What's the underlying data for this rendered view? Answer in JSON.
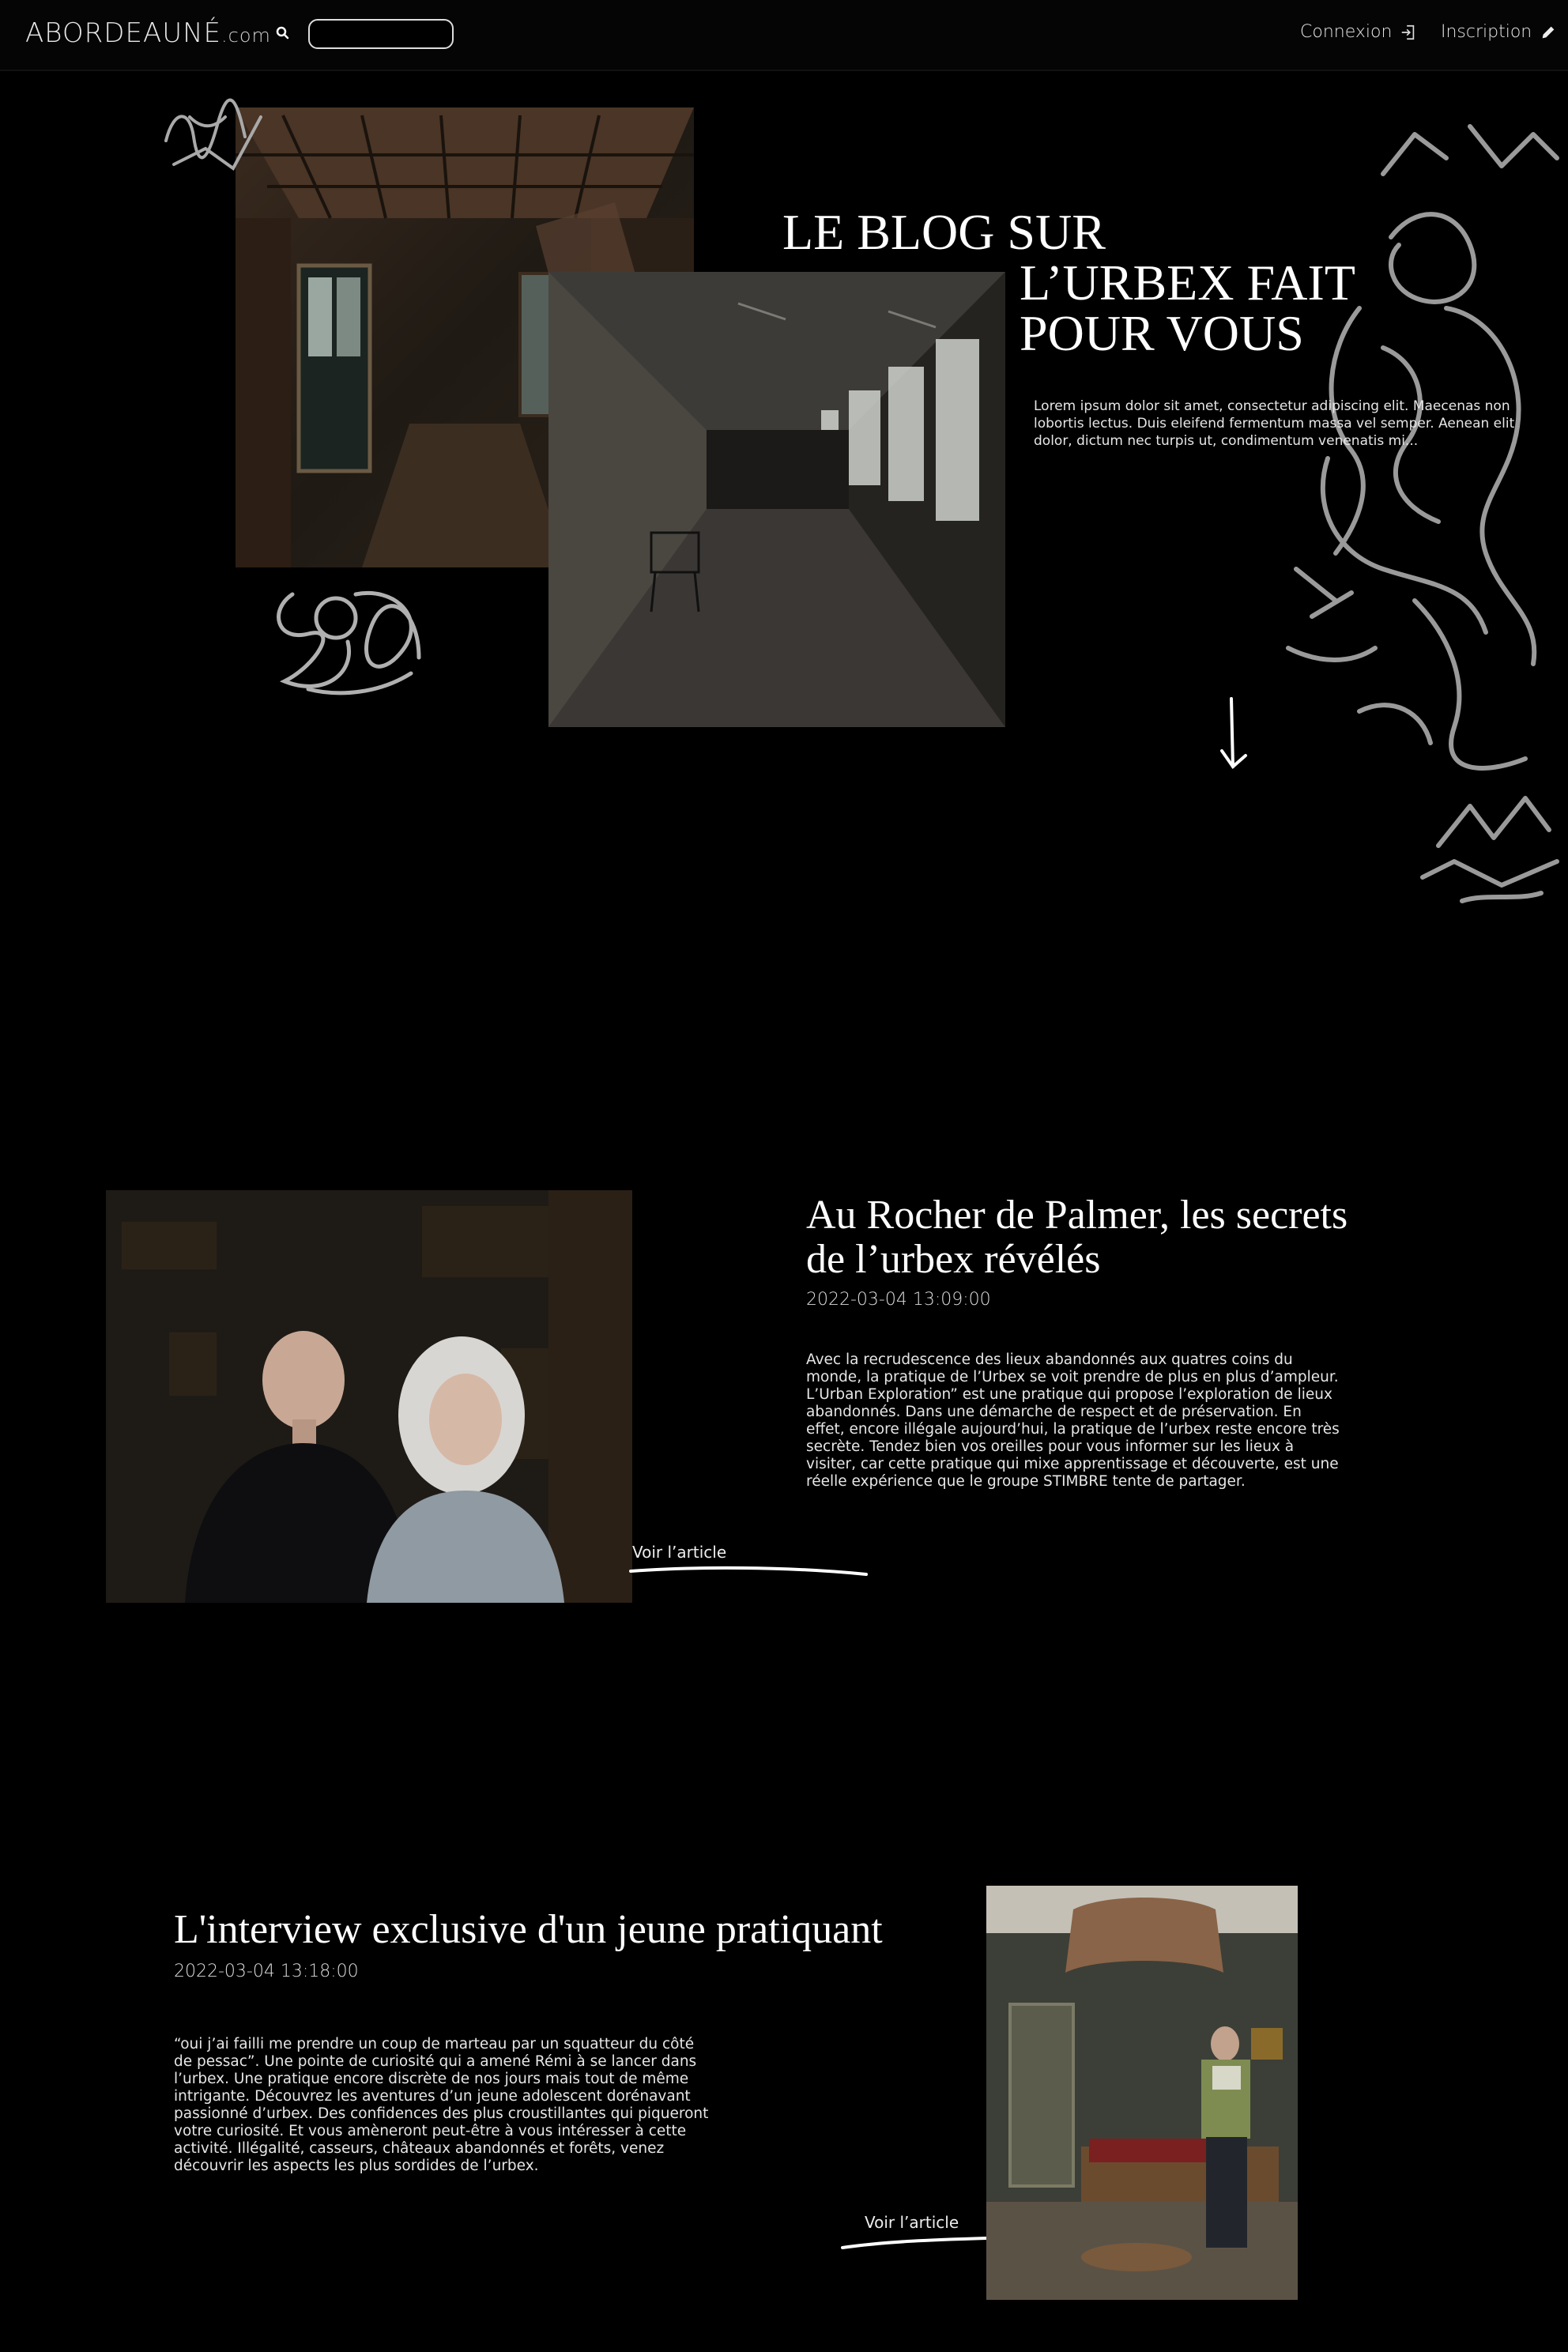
{
  "header": {
    "brand_main": "ABORDEAUNÉ",
    "brand_suffix": ".com",
    "search_placeholder": "",
    "login_label": "Connexion",
    "signup_label": "Inscription"
  },
  "hero": {
    "title_line1": "LE BLOG SUR",
    "title_line2": "L’URBEX FAIT",
    "title_line3": "POUR VOUS",
    "text": "Lorem ipsum dolor sit amet, consectetur adipiscing elit. Maecenas non lobortis lectus. Duis eleifend fermentum massa vel semper. Aenean elit dolor, dictum nec turpis ut, condimentum venenatis mi..."
  },
  "articles": [
    {
      "title_line1": "Au Rocher de Palmer, les secrets",
      "title_line2": "de l’urbex révélés",
      "date": "2022-03-04 13:09:00",
      "text": "Avec la recrudescence des lieux abandonnés aux quatres coins du monde, la pratique de l’Urbex se voit prendre de plus en plus d’ampleur. L’Urban Exploration” est une pratique qui propose l’exploration de lieux abandonnés. Dans une démarche de respect et de préservation. En effet, encore illégale aujourd’hui, la pratique de l’urbex reste encore très secrète. Tendez bien vos oreilles pour vous informer sur les lieux à visiter, car cette pratique qui mixe apprentissage et découverte, est une réelle expérience que le groupe STIMBRE tente de partager.",
      "link_label": "Voir l’article"
    },
    {
      "title": "L'interview exclusive d'un jeune pratiquant",
      "date": "2022-03-04 13:18:00",
      "text": "“oui j’ai failli me prendre un coup de marteau par un squatteur du côté de pessac”. Une pointe de curiosité qui a amené Rémi à se lancer dans l’urbex. Une pratique encore discrète de nos jours mais tout de même intrigante. Découvrez les aventures d’un jeune adolescent dorénavant passionné d’urbex. Des confidences des plus croustillantes qui piqueront votre curiosité. Et vous amèneront peut-être à vous intéresser à cette activité. Illégalité, casseurs, châteaux abandonnés et forêts, venez découvrir les aspects les plus sordides de l’urbex.",
      "link_label": "Voir l’article"
    }
  ],
  "colors": {
    "background": "#000000",
    "text": "#ffffff",
    "graffiti": "#9a9a9a"
  },
  "icons": [
    "search-icon",
    "login-icon",
    "pencil-icon",
    "arrow-down-icon"
  ]
}
